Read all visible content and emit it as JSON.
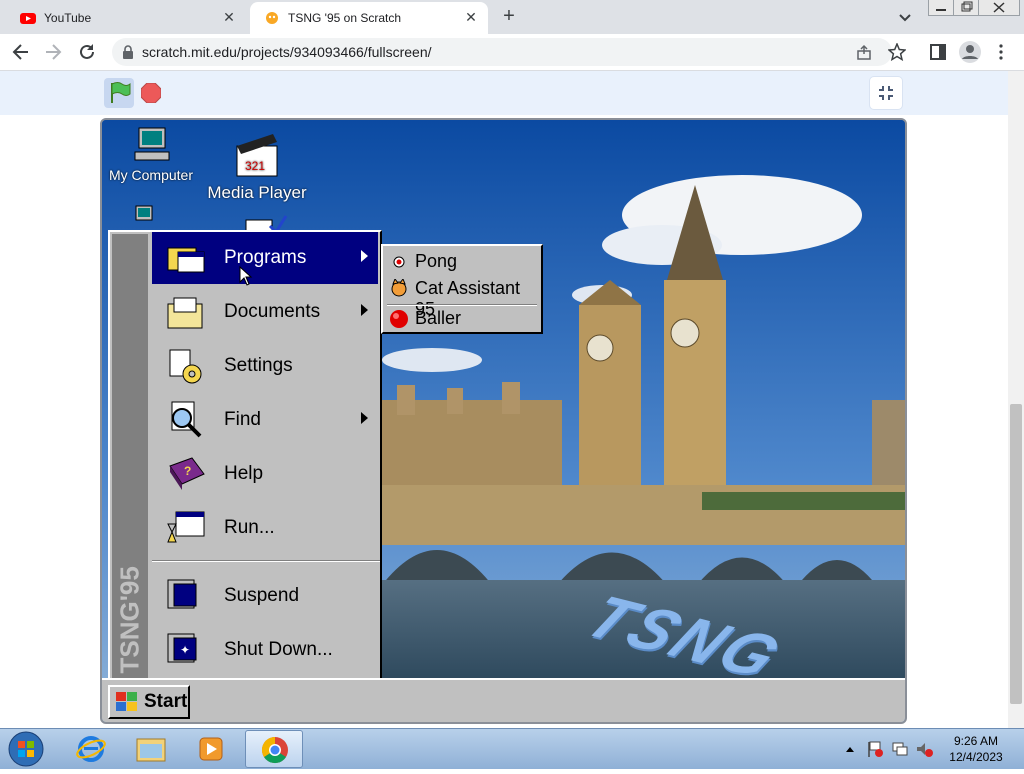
{
  "browser": {
    "tabs": [
      {
        "title": "YouTube",
        "active": false
      },
      {
        "title": "TSNG '95 on Scratch",
        "active": true
      }
    ],
    "url": "scratch.mit.edu/projects/934093466/fullscreen/"
  },
  "desktop": {
    "icons": [
      {
        "label": "My Computer"
      },
      {
        "label": "Media Player"
      }
    ],
    "stage_watermark": "TSNG"
  },
  "start_menu": {
    "side_label": "TSNG'95",
    "items": [
      {
        "label": "Programs",
        "submenu": true,
        "selected": true
      },
      {
        "label": "Documents",
        "submenu": true
      },
      {
        "label": "Settings",
        "submenu": false
      },
      {
        "label": "Find",
        "submenu": true
      },
      {
        "label": "Help",
        "submenu": false
      },
      {
        "label": "Run...",
        "submenu": false
      },
      {
        "label": "Suspend",
        "submenu": false
      },
      {
        "label": "Shut Down...",
        "submenu": false
      }
    ]
  },
  "programs_submenu": {
    "items": [
      {
        "label": "Pong"
      },
      {
        "label": "Cat Assistant 95"
      },
      {
        "label": "Baller"
      }
    ]
  },
  "w95_taskbar": {
    "start_label": "Start"
  },
  "windows_taskbar": {
    "time": "9:26 AM",
    "date": "12/4/2023"
  },
  "colors": {
    "menu_highlight": "#000080",
    "chrome_bg": "#dee1e6",
    "scratch_bar": "#e9f1fc"
  }
}
